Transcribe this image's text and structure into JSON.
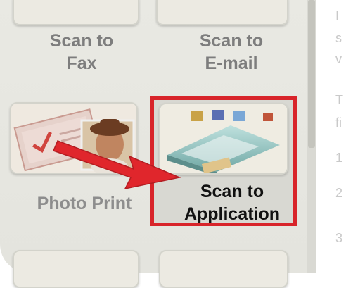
{
  "tiles": {
    "scan_to_fax": {
      "line1": "Scan to",
      "line2": "Fax"
    },
    "scan_to_email": {
      "line1": "Scan to",
      "line2": "E-mail"
    },
    "photo_print": {
      "label": "Photo Print"
    },
    "scan_to_application": {
      "line1": "Scan to",
      "line2": "Application"
    }
  },
  "right_panel_chars": [
    "I",
    "s",
    "v",
    "T",
    "fi",
    "1",
    "2",
    "3"
  ],
  "colors": {
    "highlight_border": "#d8242a",
    "arrow": "#e0262c"
  }
}
